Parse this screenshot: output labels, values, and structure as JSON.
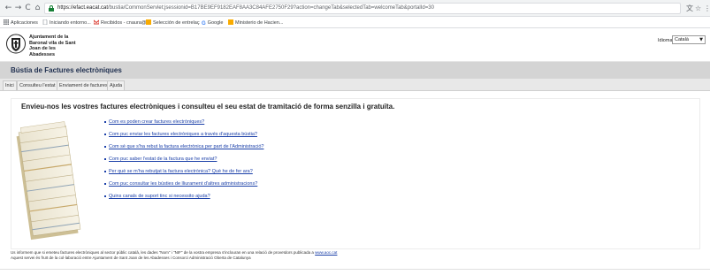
{
  "browser": {
    "url_host": "https://efact.eacat.cat",
    "url_path": "/bustia/CommonServlet;jsessionid=B17BE9EF9182EAF8AA3C84AFE2750F29?action=changeTab&selectedTab=welcomeTab&portalId=30",
    "back_glyph": "←",
    "forward_glyph": "→",
    "reload_glyph": "C",
    "home_glyph": "⌂",
    "translate_glyph": "文",
    "star_glyph": "☆",
    "menu_glyph": "⋮"
  },
  "bookmarks": [
    {
      "label": "Aplicaciones",
      "icon": "apps-icon",
      "color": "#5f6368"
    },
    {
      "label": "Iniciando entorno...",
      "icon": "page-icon",
      "color": "#9aa0a6"
    },
    {
      "label": "Recibidos - cnaura@",
      "icon": "gmail-icon",
      "color": "#d93025"
    },
    {
      "label": "Selección de entrelaç",
      "icon": "bookmark-yellow-icon",
      "color": "#f9ab00"
    },
    {
      "label": "Google",
      "icon": "google-icon",
      "color": "#4285f4"
    },
    {
      "label": "Ministerio de Hacien...",
      "icon": "bookmark-yellow-icon",
      "color": "#f9ab00"
    }
  ],
  "header": {
    "org_line1": "Ajuntament de la",
    "org_line2": "Baronal vila de Sant",
    "org_line3": "Joan de les Abadesses",
    "language_label": "Idioma",
    "language_value": "Català",
    "select_arrow": "▼"
  },
  "title": "Bústia de Factures electròniques",
  "tabs": [
    {
      "label": "Inici"
    },
    {
      "label": "Consulteu l'estat"
    },
    {
      "label": "Enviament de factures"
    },
    {
      "label": "Ajuda"
    }
  ],
  "main": {
    "headline": "Envieu-nos les vostres factures electròniques i consulteu el seu estat de tramitació de forma senzilla i gratuïta.",
    "links": [
      "Com es poden crear factures electròniques?",
      "Com puc enviar les factures electròniques a través d'aquesta bústia?",
      "Com sé que s'ha rebut la factura electrònica per part de l'Administració?",
      "Com puc saber l'estat de la factura que he enviat?",
      "Per què se m'ha rebutjat la factura electrònica? Què he de fer ara?",
      "Com puc consultar les bústies de lliurament d'altres administracions?",
      "Quins canals de suport tinc si necessito ajuda?"
    ]
  },
  "footer": {
    "line1": "Us informem que si emeteu factures electròniques al sector públic català, les dades \"Nom\" i \"NIF\" de la vostra empresa s'inclouran en una relació de proveïdors publicada a ",
    "line1_link": "www.aoc.cat",
    "line2": "Aquest servei és fruït de la col·laboració entre Ajuntament de Sant Joan de les Abadesses i Consorci Administració Oberta de Catalunya"
  },
  "colors": {
    "title_band": "#d4d4d4",
    "link": "#1a3fa8",
    "title_text": "#1f2f4f"
  }
}
